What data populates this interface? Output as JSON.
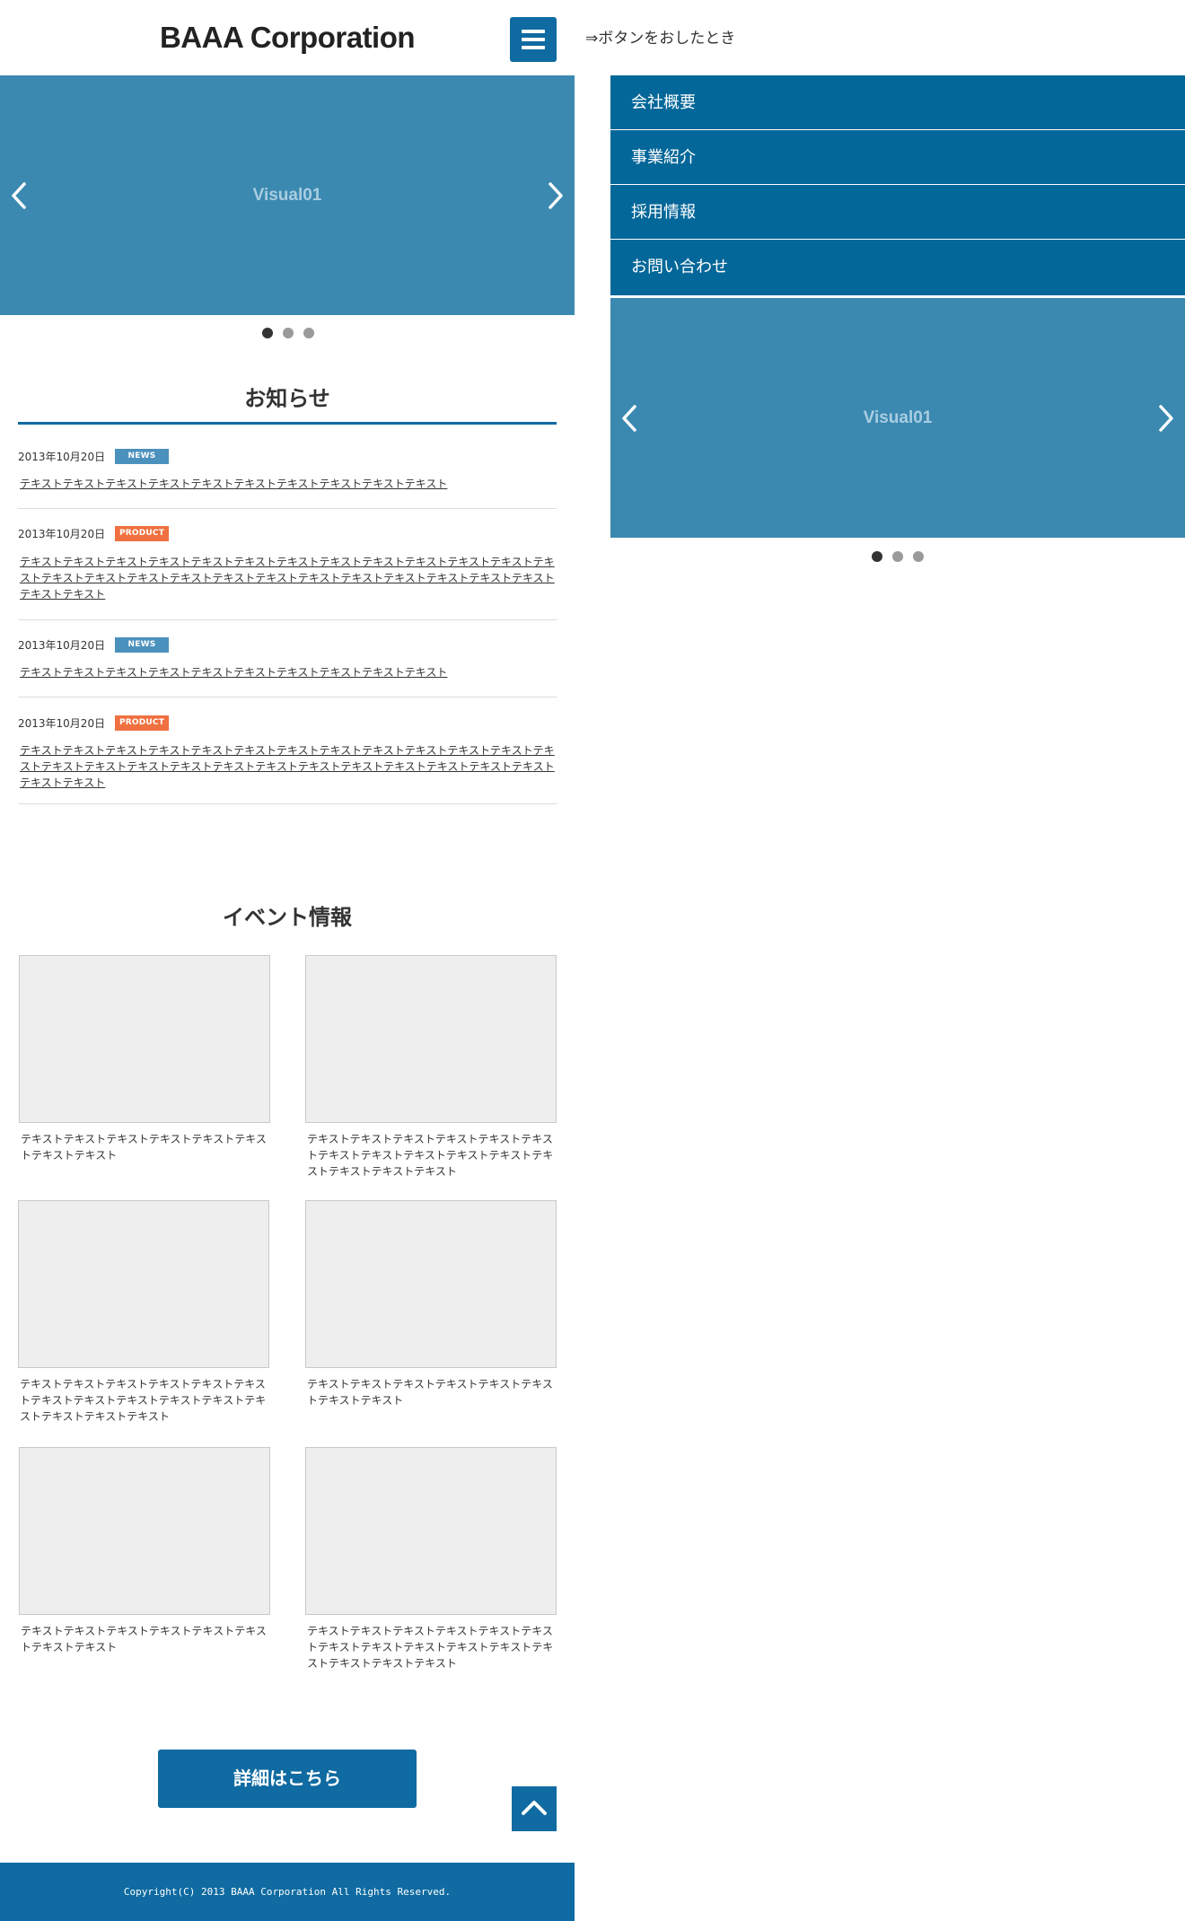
{
  "header": {
    "logo": "BAAA Corporation",
    "menu_button": "menu-icon"
  },
  "slider": {
    "slide_label": "Visual01",
    "dots": 3,
    "active_dot": 1
  },
  "news": {
    "title": "お知らせ",
    "items": [
      {
        "date": "2013年10月20日",
        "tag": "NEWS",
        "tag_type": "news",
        "text": "テキストテキストテキストテキストテキストテキストテキストテキストテキストテキスト"
      },
      {
        "date": "2013年10月20日",
        "tag": "PRODUCT",
        "tag_type": "product",
        "text": "テキストテキストテキストテキストテキストテキストテキストテキストテキストテキストテキストテキストテキストテキストテキストテキストテキストテキストテキストテキストテキストテキストテキストテキストテキストテキストテキスト"
      },
      {
        "date": "2013年10月20日",
        "tag": "NEWS",
        "tag_type": "news",
        "text": "テキストテキストテキストテキストテキストテキストテキストテキストテキストテキスト"
      },
      {
        "date": "2013年10月20日",
        "tag": "PRODUCT",
        "tag_type": "product",
        "text": "テキストテキストテキストテキストテキストテキストテキストテキストテキストテキストテキストテキストテキストテキストテキストテキストテキストテキストテキストテキストテキストテキストテキストテキストテキストテキストテキスト"
      }
    ]
  },
  "events": {
    "title": "イベント情報",
    "items": [
      {
        "text": "テキストテキストテキストテキストテキストテキストテキストテキスト"
      },
      {
        "text": "テキストテキストテキストテキストテキストテキストテキストテキストテキストテキストテキストテキストテキストテキストテキスト"
      },
      {
        "text": "テキストテキストテキストテキストテキストテキストテキストテキストテキストテキストテキストテキストテキストテキストテキスト"
      },
      {
        "text": "テキストテキストテキストテキストテキストテキストテキストテキスト"
      },
      {
        "text": "テキストテキストテキストテキストテキストテキストテキストテキスト"
      },
      {
        "text": "テキストテキストテキストテキストテキストテキストテキストテキストテキストテキストテキストテキストテキストテキストテキスト"
      }
    ]
  },
  "detail_button": "詳細はこちら",
  "to_top_icon": "chevron-up-icon",
  "footer": {
    "copyright": "Copyright(C) 2013 BAAA Corporation All Rights Reserved."
  },
  "menu_state": {
    "caption": "⇒ボタンをおしたとき",
    "items": [
      "会社概要",
      "事業紹介",
      "採用情報",
      "お問い合わせ"
    ]
  },
  "colors": {
    "brand": "#0f6ba1",
    "menu": "#046799",
    "slider": "#3b89b1",
    "news_tag": "#4b91be",
    "product_tag": "#f07040"
  }
}
